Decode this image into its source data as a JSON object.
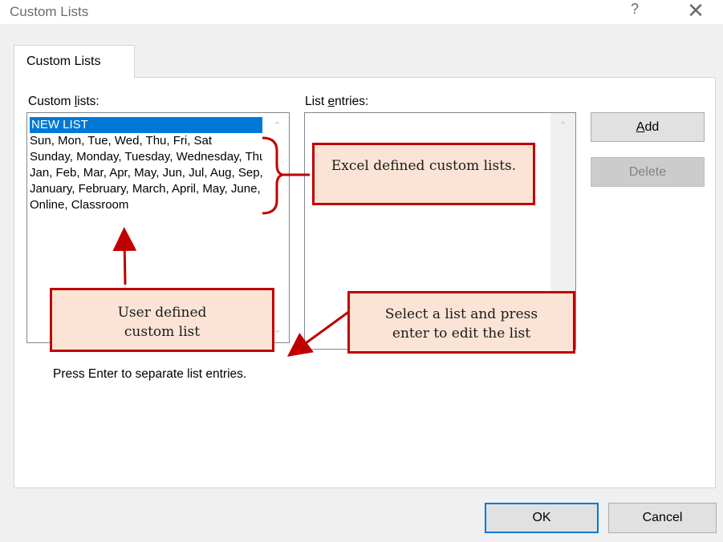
{
  "window": {
    "title": "Custom Lists",
    "help_glyph": "?",
    "close_glyph": "✕"
  },
  "tabs": [
    {
      "label": "Custom Lists"
    }
  ],
  "custom_lists": {
    "label_pre": "Custom ",
    "label_acc": "l",
    "label_post": "ists:",
    "items": [
      "NEW LIST",
      "Sun, Mon, Tue, Wed, Thu, Fri, Sat",
      "Sunday, Monday, Tuesday, Wednesday, Thursday, Friday, Saturday",
      "Jan, Feb, Mar, Apr, May, Jun, Jul, Aug, Sep, Oct, Nov, Dec",
      "January, February, March, April, May, June, July, August, September, October, November, December",
      "Online, Classroom"
    ],
    "selected_index": 0
  },
  "list_entries": {
    "label_pre": "List ",
    "label_acc": "e",
    "label_post": "ntries:"
  },
  "buttons": {
    "add_acc": "A",
    "add_post": "dd",
    "delete": "Delete",
    "ok": "OK",
    "cancel": "Cancel"
  },
  "hint": "Press Enter to separate list entries.",
  "annotations": {
    "excel_defined": "Excel defined custom lists.",
    "user_defined": "User defined custom list",
    "select_list": "Select a list and press enter to edit the list",
    "callout_color": "#c00000",
    "callout_fill": "#fbe4d5"
  },
  "colors": {
    "selection": "#0078d7",
    "dialog_bg": "#f0f0f0"
  }
}
